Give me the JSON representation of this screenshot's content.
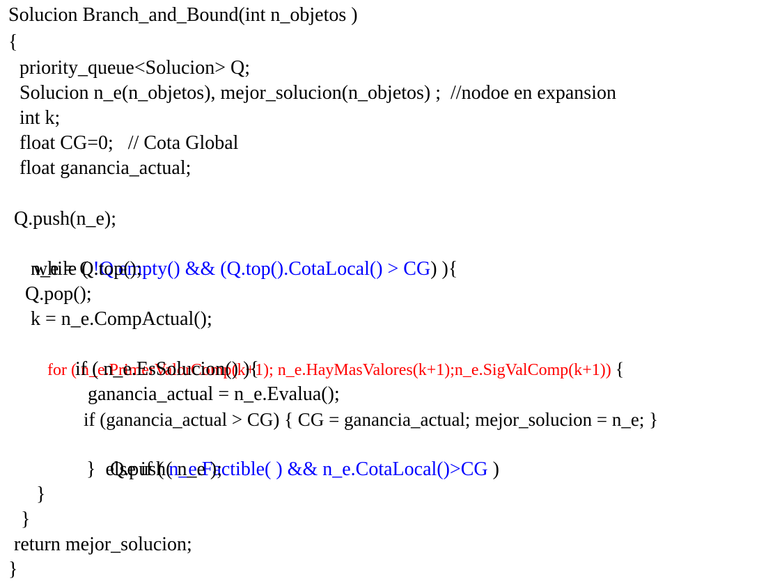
{
  "colors": {
    "text": "#000000",
    "blue": "#0000ff",
    "red": "#ff0000",
    "background": "#ffffff"
  },
  "code": {
    "signature": "Solucion Branch_and_Bound(int n_objetos )",
    "open_brace": "{",
    "decl_queue": "priority_queue<Solucion> Q;",
    "decl_solutions": "Solucion n_e(n_objetos), mejor_solucion(n_objetos) ;  //nodoe en expansion",
    "decl_k": "int k;",
    "decl_cg": "float CG=0;   // Cota Global",
    "decl_ganancia": "float ganancia_actual;",
    "push_initial": "Q.push(n_e);",
    "while_start": "while ( ",
    "while_condition": "!Q.empty() && (Q.top().CotaLocal() > CG",
    "while_end": ") ){",
    "assign_top": "n_e = Q.top();",
    "pop": "Q.pop();",
    "assign_k": "k = n_e.CompActual();",
    "for_header": "for ( n_e.PrimerValorComp(k+1); n_e.HayMasValores(k+1);n_e.SigValComp(k+1)) ",
    "for_brace": "{",
    "if_solution": "if ( n_e.EsSolucion() ){",
    "evaluate": "ganancia_actual = n_e.Evalua();",
    "update_best": "if (ganancia_actual > CG) { CG = ganancia_actual; mejor_solucion = n_e; }",
    "else_if_start": "}  else if ( ",
    "else_if_condition": "n_e.Factible( ) && n_e.CotaLocal()>CG",
    "else_if_end": " )",
    "push_node": "Q.push( n_e );",
    "close_for": "}",
    "close_while": "}",
    "return": "return mejor_solucion;",
    "close_brace": "}"
  }
}
